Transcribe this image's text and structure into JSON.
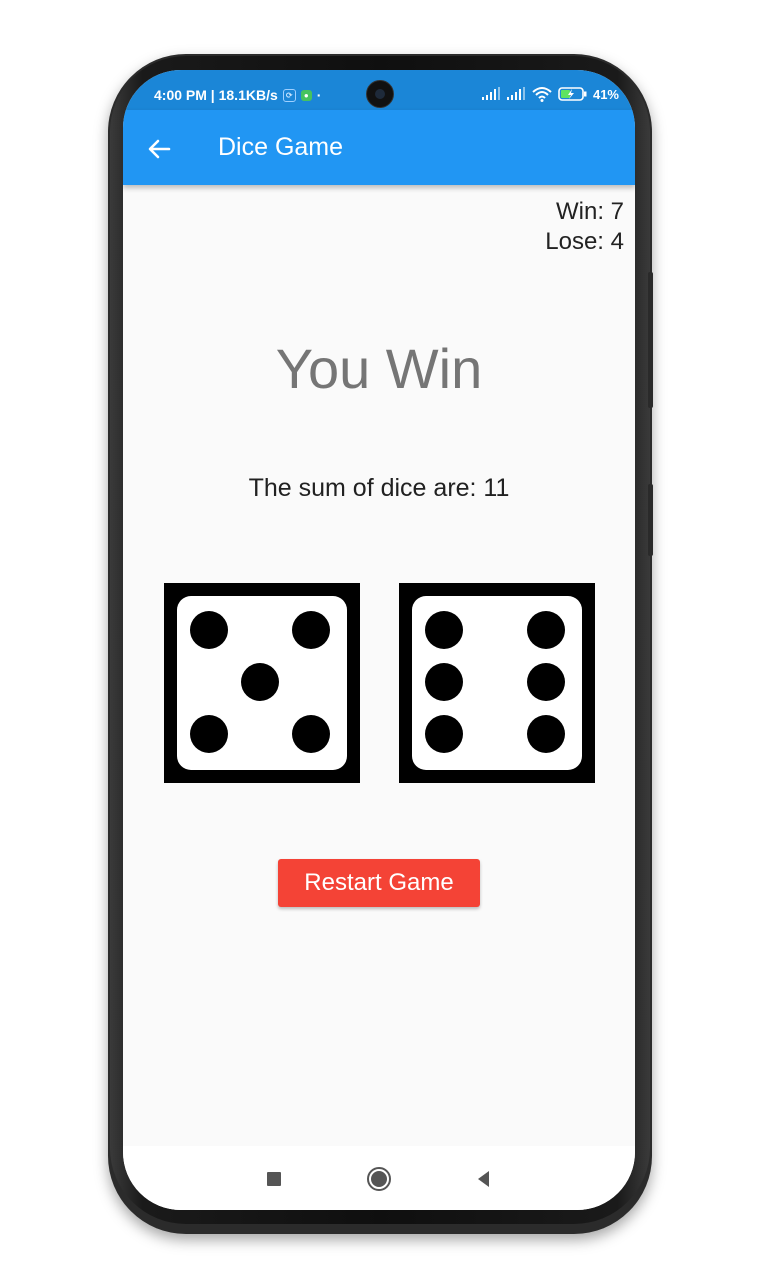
{
  "status_bar": {
    "left_text": "4:00 PM | 18.1KB/s",
    "battery_text": "41%"
  },
  "app_bar": {
    "title": "Dice Game"
  },
  "scoreboard": {
    "win_text": "Win: 7",
    "lose_text": "Lose: 4"
  },
  "result": {
    "title": "You Win",
    "sum_text": "The sum of dice are: 11"
  },
  "dice": [
    {
      "value": 5
    },
    {
      "value": 6
    }
  ],
  "actions": {
    "restart_label": "Restart Game"
  },
  "colors": {
    "app_bar": "#2196f3",
    "status_bar": "#1b86d7",
    "restart_button": "#f44336",
    "result_title": "#757575",
    "background": "#fafafa"
  },
  "icons": {
    "back": "arrow-back-icon",
    "nav_recent": "square-icon",
    "nav_home": "circle-icon",
    "nav_back": "triangle-back-icon"
  }
}
